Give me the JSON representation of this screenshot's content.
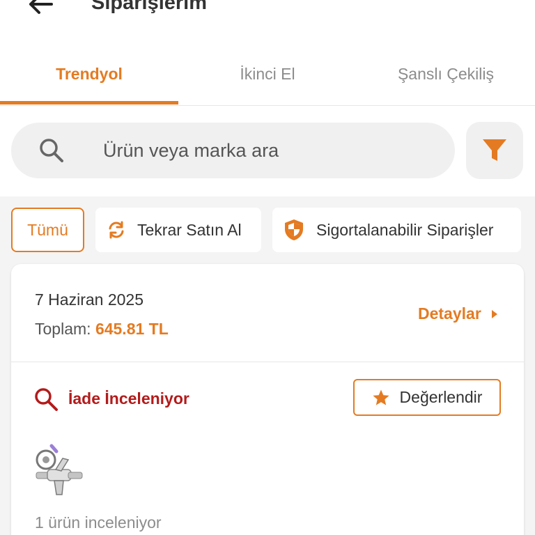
{
  "header": {
    "title": "Siparişlerim"
  },
  "tabs": [
    {
      "label": "Trendyol",
      "active": true
    },
    {
      "label": "İkinci El",
      "active": false
    },
    {
      "label": "Şanslı Çekiliş",
      "active": false
    }
  ],
  "search": {
    "placeholder": "Ürün veya marka ara"
  },
  "chips": {
    "all": "Tümü",
    "rebuy": "Tekrar Satın Al",
    "insurable": "Sigortalanabilir Siparişler"
  },
  "order": {
    "date": "7 Haziran 2025",
    "total_label": "Toplam:",
    "total_value": "645.81 TL",
    "details_label": "Detaylar",
    "status": "İade İnceleniyor",
    "rate_label": "Değerlendir",
    "product_note": "1 ürün inceleniyor"
  },
  "colors": {
    "accent": "#e47b22",
    "status_red": "#b31b1b"
  }
}
